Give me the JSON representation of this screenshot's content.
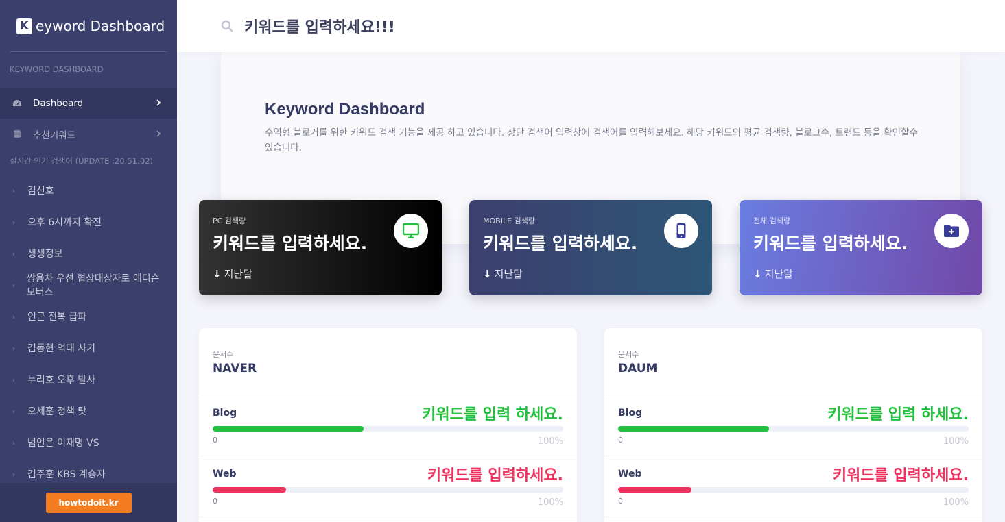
{
  "brand": {
    "logo_letter": "K",
    "name": "eyword Dashboard"
  },
  "sidebar": {
    "section_title": "KEYWORD DASHBOARD",
    "nav": [
      {
        "label": "Dashboard",
        "icon": "gauge-icon",
        "active": true
      },
      {
        "label": "추천키워드",
        "icon": "database-icon",
        "active": false
      }
    ],
    "realtime_title": "실시간 인기 검색어 (UPDATE :20:51:02)",
    "trending": [
      "김선호",
      "오후 6시까지 확진",
      "생생정보",
      "쌍용차 우선 협상대상자로 에디슨모터스",
      "인근 전복 급파",
      "김동현 억대 사기",
      "누리호 오후 발사",
      "오세훈 정책 탓",
      "범인은 이재명 VS",
      "김주훈 KBS 계승자"
    ],
    "footer_button": "howtodoit.kr"
  },
  "search": {
    "value": "키워드를 입력하세요!!!",
    "placeholder": "키워드를 입력하세요!!!"
  },
  "hero": {
    "title": "Keyword Dashboard",
    "description": "수익형 블로거를 위한 키워드 검색 기능을 제공 하고 있습니다. 상단 검색어 입력창에 검색어를 입력해보세요. 해당 키워드의 평균 검색량, 블로그수, 트랜드 등을 확인할수 있습니다."
  },
  "stats": [
    {
      "label": "PC 검색량",
      "value": "키워드를 입력하세요.",
      "sub": "지난달",
      "icon": "monitor-icon",
      "icon_color": "#22c03c"
    },
    {
      "label": "MOBILE 검색량",
      "value": "키워드를 입력하세요.",
      "sub": "지난달",
      "icon": "mobile-icon",
      "icon_color": "#3b3f9c"
    },
    {
      "label": "전체 검색량",
      "value": "키워드를 입력하세요.",
      "sub": "지난달",
      "icon": "folder-plus-icon",
      "icon_color": "#3b3f9c"
    }
  ],
  "docs": [
    {
      "sub": "문서수",
      "title": "NAVER",
      "rows": [
        {
          "label": "Blog",
          "value": "키워드를 입력 하세요.",
          "min": "0",
          "max": "100%",
          "progress": 0.43
        },
        {
          "label": "Web",
          "value": "키워드를 입력하세요.",
          "min": "0",
          "max": "100%",
          "progress": 0.21
        }
      ]
    },
    {
      "sub": "문서수",
      "title": "DAUM",
      "rows": [
        {
          "label": "Blog",
          "value": "키워드를 입력 하세요.",
          "min": "0",
          "max": "100%",
          "progress": 0.43
        },
        {
          "label": "Web",
          "value": "키워드를 입력하세요.",
          "min": "0",
          "max": "100%",
          "progress": 0.21
        }
      ]
    }
  ],
  "colors": {
    "sidebar": "#3b3f6c",
    "accent_green": "#22c03c",
    "accent_red": "#ee335e",
    "footer_button": "#f47c20"
  }
}
